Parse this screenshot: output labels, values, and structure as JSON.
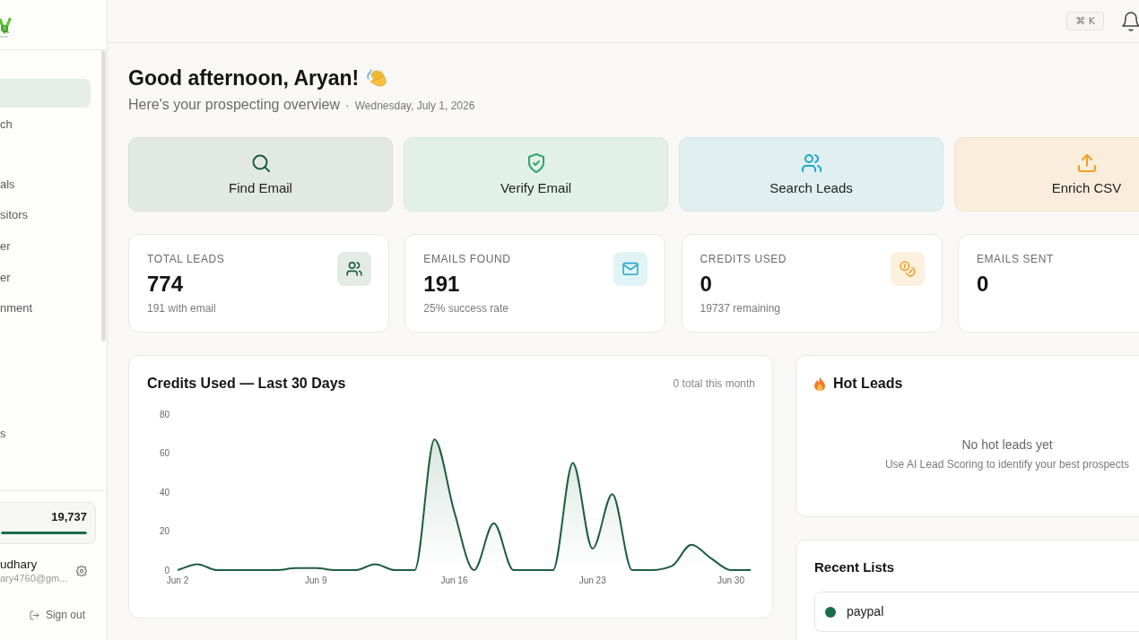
{
  "sidebar": {
    "sections": [
      {
        "items": [
          {
            "selected": true
          },
          {
            "label": "ch",
            "selected": false
          }
        ]
      },
      {
        "items": [
          {
            "label": "als",
            "selected": false
          },
          {
            "label": "sitors",
            "selected": false
          },
          {
            "label": "er",
            "selected": false
          },
          {
            "label": "er",
            "selected": false
          },
          {
            "label": "nment",
            "selected": false
          }
        ]
      },
      {
        "items": [
          {
            "label": "s",
            "selected": false
          }
        ]
      }
    ],
    "credits": {
      "value": "19,737",
      "level": 1
    },
    "user": {
      "name": "udhary",
      "email": "ary4760@gm..."
    },
    "sign_out": "Sign out"
  },
  "header": {
    "shortcut": "⌘ K"
  },
  "greeting": {
    "title": "Good afternoon, Aryan!",
    "subtitle": "Here's your prospecting overview",
    "separator": "·",
    "date": "Wednesday, July 1, 2026"
  },
  "actions": [
    {
      "kind": "find",
      "label": "Find Email"
    },
    {
      "kind": "verify",
      "label": "Verify Email"
    },
    {
      "kind": "leads",
      "label": "Search Leads"
    },
    {
      "kind": "enrich",
      "label": "Enrich CSV"
    }
  ],
  "stats": [
    {
      "kind": "leads",
      "label": "TOTAL LEADS",
      "value": "774",
      "note": "191 with email"
    },
    {
      "kind": "emails",
      "label": "EMAILS FOUND",
      "value": "191",
      "note": "25% success rate"
    },
    {
      "kind": "credits",
      "label": "CREDITS USED",
      "value": "0",
      "note": "19737 remaining"
    },
    {
      "kind": "sent",
      "label": "EMAILS SENT",
      "value": "0"
    }
  ],
  "credits_chart": {
    "summary": "0 total this month",
    "chart_data": [
      {
        "type": "area",
        "title": "Credits Used — Last 30 Days",
        "categories": [
          "Jun 2",
          null,
          null,
          null,
          null,
          null,
          null,
          "Jun 9",
          null,
          null,
          null,
          null,
          null,
          null,
          "Jun 16",
          null,
          null,
          null,
          null,
          null,
          null,
          "Jun 23",
          null,
          null,
          null,
          null,
          null,
          null,
          "Jun 30",
          null
        ],
        "values": [
          0,
          3,
          0,
          0,
          0,
          0,
          1,
          1,
          0,
          0,
          3,
          0,
          0,
          67,
          30,
          0,
          24,
          0,
          0,
          0,
          55,
          11,
          39,
          0,
          0,
          2,
          13,
          6,
          0,
          0
        ],
        "color": "#1d5e40",
        "ylim": [
          0,
          80
        ],
        "yticks": [
          0,
          20,
          40,
          60,
          80
        ]
      }
    ]
  },
  "hot_leads": {
    "title": "Hot Leads",
    "empty_title": "No hot leads yet",
    "empty_text": "Use AI Lead Scoring to identify your best prospects"
  },
  "recent_lists": {
    "title": "Recent Lists",
    "items": [
      {
        "name": "paypal",
        "color": "#1b6b4c"
      }
    ]
  }
}
